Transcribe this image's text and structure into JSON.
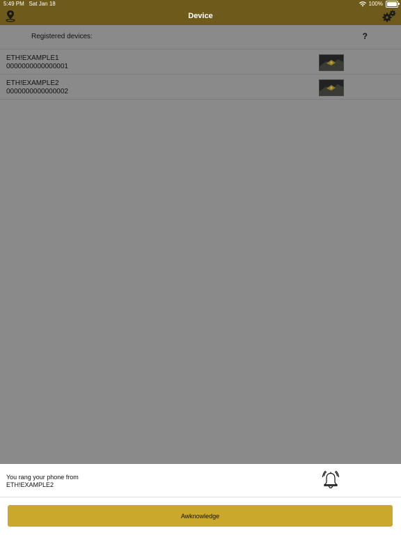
{
  "status_bar": {
    "time": "5:49 PM",
    "date": "Sat Jan 18",
    "battery": "100%",
    "battery_level": 1.0
  },
  "nav": {
    "title": "Device",
    "left_icon": "location-pin-icon",
    "right_icon": "gears-icon"
  },
  "list": {
    "header_label": "Registered devices:",
    "help_label": "?",
    "devices": [
      {
        "name": "ETH!EXAMPLE1",
        "serial": "0000000000000001"
      },
      {
        "name": "ETH!EXAMPLE2",
        "serial": "0000000000000002"
      }
    ]
  },
  "notice": {
    "line1": "You rang your phone from",
    "line2": "ETH!EXAMPLE2",
    "icon": "bell-ringing-icon"
  },
  "acknowledge_label": "Awknowledge",
  "colors": {
    "navbar": "#6e5a1b",
    "background": "#8a8a8a",
    "accent_button": "#c9a82c"
  }
}
